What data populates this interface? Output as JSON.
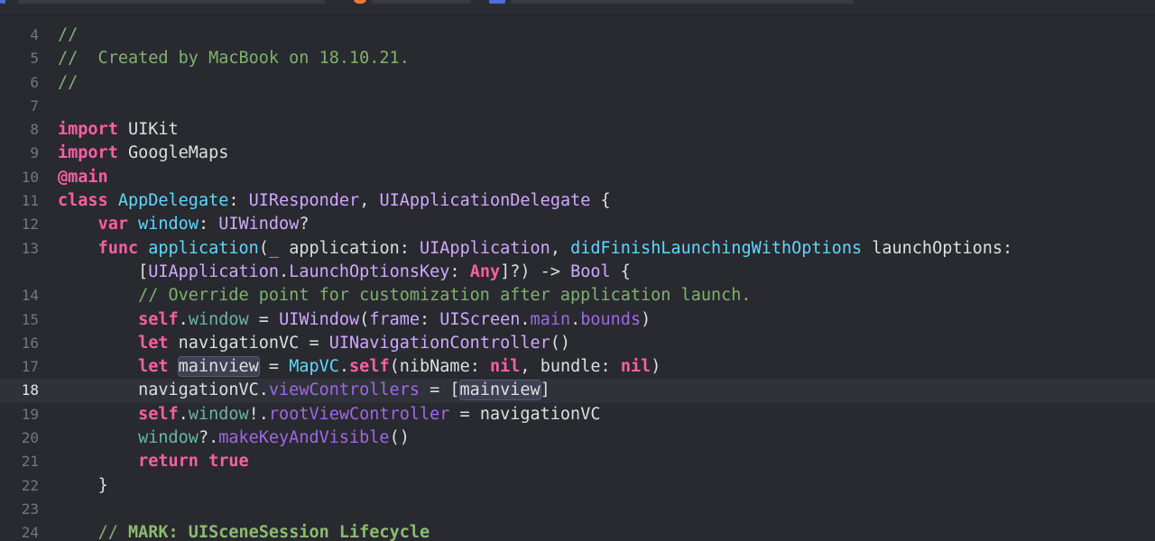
{
  "editor": {
    "current_line": "18",
    "lines": [
      {
        "num": "4",
        "indent": "",
        "tokens": [
          {
            "t": "//",
            "c": "comment"
          }
        ]
      },
      {
        "num": "5",
        "indent": "",
        "tokens": [
          {
            "t": "//  Created by MacBook on 18.10.21.",
            "c": "comment"
          }
        ]
      },
      {
        "num": "6",
        "indent": "",
        "tokens": [
          {
            "t": "//",
            "c": "comment"
          }
        ]
      },
      {
        "num": "7",
        "indent": "",
        "tokens": []
      },
      {
        "num": "8",
        "indent": "",
        "tokens": [
          {
            "t": "import",
            "c": "kw"
          },
          {
            "t": " UIKit",
            "c": "plain"
          }
        ]
      },
      {
        "num": "9",
        "indent": "",
        "tokens": [
          {
            "t": "import",
            "c": "kw"
          },
          {
            "t": " GoogleMaps",
            "c": "plain"
          }
        ]
      },
      {
        "num": "10",
        "indent": "",
        "tokens": [
          {
            "t": "@main",
            "c": "kw"
          }
        ]
      },
      {
        "num": "11",
        "indent": "",
        "tokens": [
          {
            "t": "class",
            "c": "kw"
          },
          {
            "t": " ",
            "c": "plain"
          },
          {
            "t": "AppDelegate",
            "c": "decl"
          },
          {
            "t": ": ",
            "c": "plain"
          },
          {
            "t": "UIResponder",
            "c": "type"
          },
          {
            "t": ", ",
            "c": "plain"
          },
          {
            "t": "UIApplicationDelegate",
            "c": "type"
          },
          {
            "t": " {",
            "c": "plain"
          }
        ]
      },
      {
        "num": "12",
        "indent": "    ",
        "tokens": [
          {
            "t": "var",
            "c": "kw"
          },
          {
            "t": " ",
            "c": "plain"
          },
          {
            "t": "window",
            "c": "decl"
          },
          {
            "t": ": ",
            "c": "plain"
          },
          {
            "t": "UIWindow",
            "c": "type"
          },
          {
            "t": "?",
            "c": "plain"
          }
        ]
      },
      {
        "num": "13",
        "indent": "    ",
        "tokens": [
          {
            "t": "func",
            "c": "kw"
          },
          {
            "t": " ",
            "c": "plain"
          },
          {
            "t": "application",
            "c": "decl"
          },
          {
            "t": "(",
            "c": "plain"
          },
          {
            "t": "_",
            "c": "decl"
          },
          {
            "t": " application: ",
            "c": "plain"
          },
          {
            "t": "UIApplication",
            "c": "type"
          },
          {
            "t": ", ",
            "c": "plain"
          },
          {
            "t": "didFinishLaunchingWithOptions",
            "c": "decl"
          },
          {
            "t": " launchOptions:",
            "c": "plain"
          }
        ]
      },
      {
        "num": "",
        "indent": "        ",
        "tokens": [
          {
            "t": "[",
            "c": "plain"
          },
          {
            "t": "UIApplication",
            "c": "type"
          },
          {
            "t": ".",
            "c": "plain"
          },
          {
            "t": "LaunchOptionsKey",
            "c": "type"
          },
          {
            "t": ": ",
            "c": "plain"
          },
          {
            "t": "Any",
            "c": "kw"
          },
          {
            "t": "]?) -> ",
            "c": "plain"
          },
          {
            "t": "Bool",
            "c": "type"
          },
          {
            "t": " {",
            "c": "plain"
          }
        ]
      },
      {
        "num": "14",
        "indent": "        ",
        "tokens": [
          {
            "t": "// Override point for customization after application launch.",
            "c": "comment"
          }
        ]
      },
      {
        "num": "15",
        "indent": "        ",
        "tokens": [
          {
            "t": "self",
            "c": "kw"
          },
          {
            "t": ".",
            "c": "plain"
          },
          {
            "t": "window",
            "c": "func"
          },
          {
            "t": " = ",
            "c": "plain"
          },
          {
            "t": "UIWindow",
            "c": "type"
          },
          {
            "t": "(",
            "c": "plain"
          },
          {
            "t": "frame",
            "c": "sys"
          },
          {
            "t": ": ",
            "c": "plain"
          },
          {
            "t": "UIScreen",
            "c": "type"
          },
          {
            "t": ".",
            "c": "plain"
          },
          {
            "t": "main",
            "c": "prop"
          },
          {
            "t": ".",
            "c": "plain"
          },
          {
            "t": "bounds",
            "c": "prop"
          },
          {
            "t": ")",
            "c": "plain"
          }
        ]
      },
      {
        "num": "16",
        "indent": "        ",
        "tokens": [
          {
            "t": "let",
            "c": "kw"
          },
          {
            "t": " navigationVC = ",
            "c": "plain"
          },
          {
            "t": "UINavigationController",
            "c": "type"
          },
          {
            "t": "()",
            "c": "plain"
          }
        ]
      },
      {
        "num": "17",
        "indent": "        ",
        "tokens": [
          {
            "t": "let",
            "c": "kw"
          },
          {
            "t": " ",
            "c": "plain"
          },
          {
            "t": "mainview",
            "c": "plain-hl"
          },
          {
            "t": " = ",
            "c": "plain"
          },
          {
            "t": "MapVC",
            "c": "decl"
          },
          {
            "t": ".",
            "c": "plain"
          },
          {
            "t": "self",
            "c": "kw"
          },
          {
            "t": "(nibName: ",
            "c": "plain"
          },
          {
            "t": "nil",
            "c": "kw"
          },
          {
            "t": ", bundle: ",
            "c": "plain"
          },
          {
            "t": "nil",
            "c": "kw"
          },
          {
            "t": ")",
            "c": "plain"
          }
        ]
      },
      {
        "num": "18",
        "indent": "        ",
        "tokens": [
          {
            "t": "navigationVC.",
            "c": "plain"
          },
          {
            "t": "viewControllers",
            "c": "prop"
          },
          {
            "t": " = [",
            "c": "plain"
          },
          {
            "t": "mainview",
            "c": "plain-hl"
          },
          {
            "t": "]",
            "c": "plain"
          }
        ]
      },
      {
        "num": "19",
        "indent": "        ",
        "tokens": [
          {
            "t": "self",
            "c": "kw"
          },
          {
            "t": ".",
            "c": "plain"
          },
          {
            "t": "window",
            "c": "func"
          },
          {
            "t": "!.",
            "c": "plain"
          },
          {
            "t": "rootViewController",
            "c": "prop"
          },
          {
            "t": " = navigationVC",
            "c": "plain"
          }
        ]
      },
      {
        "num": "20",
        "indent": "        ",
        "tokens": [
          {
            "t": "window",
            "c": "func"
          },
          {
            "t": "?.",
            "c": "plain"
          },
          {
            "t": "makeKeyAndVisible",
            "c": "prop"
          },
          {
            "t": "()",
            "c": "plain"
          }
        ]
      },
      {
        "num": "21",
        "indent": "        ",
        "tokens": [
          {
            "t": "return",
            "c": "kw"
          },
          {
            "t": " ",
            "c": "plain"
          },
          {
            "t": "true",
            "c": "kw"
          }
        ]
      },
      {
        "num": "22",
        "indent": "    ",
        "tokens": [
          {
            "t": "}",
            "c": "plain"
          }
        ]
      },
      {
        "num": "23",
        "indent": "",
        "tokens": []
      },
      {
        "num": "24",
        "indent": "    ",
        "tokens": [
          {
            "t": "// ",
            "c": "comment"
          },
          {
            "t": "MARK: UISceneSession Lifecycle",
            "c": "comment-b"
          }
        ]
      }
    ]
  },
  "colors": {
    "background": "#292a30",
    "keyword": "#fc5fa3",
    "comment": "#7eb26d",
    "type": "#d0a8ff",
    "declaration": "#5dd8ff",
    "property": "#a167e6"
  }
}
